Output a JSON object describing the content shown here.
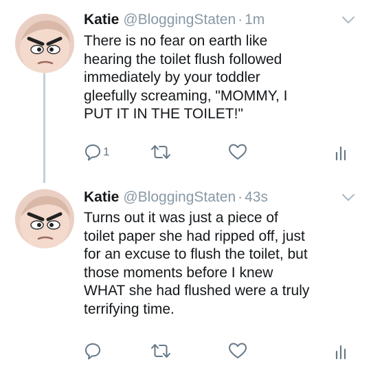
{
  "tweets": [
    {
      "name": "Katie",
      "handle": "@BloggingStaten",
      "separator": "·",
      "time": "1m",
      "text": "There is no fear on earth like\nhearing the toilet flush followed\nimmediately by your toddler\ngleefully screaming, \"MOMMY, I\nPUT IT IN THE TOILET!\"",
      "reply_count": "1",
      "icons": [
        "reply-icon",
        "retweet-icon",
        "like-icon",
        "analytics-icon"
      ]
    },
    {
      "name": "Katie",
      "handle": "@BloggingStaten",
      "separator": "·",
      "time": "43s",
      "text": "Turns out it was just a piece of\ntoilet paper she had ripped off, just\nfor an excuse to flush the toilet, but\nthose moments before I knew\nWHAT she had flushed were a truly\nterrifying time.",
      "reply_count": "",
      "icons": [
        "reply-icon",
        "retweet-icon",
        "like-icon",
        "analytics-icon"
      ]
    }
  ],
  "colors": {
    "text": "#14171a",
    "secondary": "#8899a6",
    "icon": "#657786",
    "thread_line": "#c4cfd6"
  }
}
